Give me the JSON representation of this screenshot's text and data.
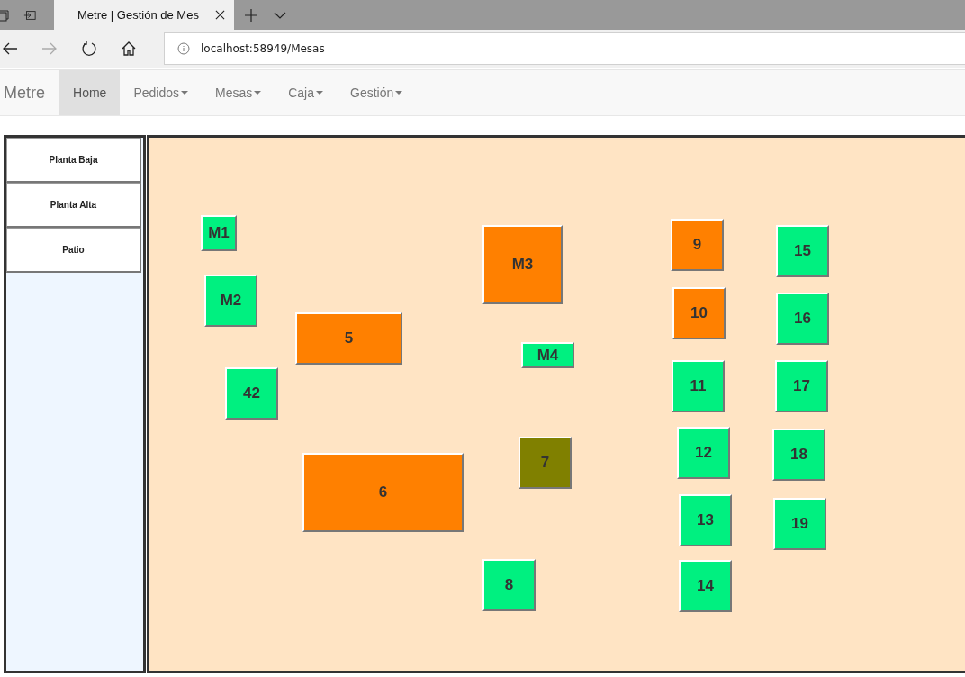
{
  "browser": {
    "tab_title": "Metre | Gestión de Mes",
    "url": "localhost:58949/Mesas"
  },
  "navbar": {
    "brand": "Metre",
    "items": [
      {
        "label": "Home",
        "selected": true,
        "dropdown": false
      },
      {
        "label": "Pedidos",
        "selected": false,
        "dropdown": true
      },
      {
        "label": "Mesas",
        "selected": false,
        "dropdown": true
      },
      {
        "label": "Caja",
        "selected": false,
        "dropdown": true
      },
      {
        "label": "Gestión",
        "selected": false,
        "dropdown": true
      }
    ]
  },
  "sidebar": {
    "items": [
      {
        "label": "Planta Baja"
      },
      {
        "label": "Planta Alta"
      },
      {
        "label": "Patio"
      }
    ]
  },
  "tables": [
    {
      "label": "M1",
      "color": "#00f080"
    },
    {
      "label": "M2",
      "color": "#00f080"
    },
    {
      "label": "42",
      "color": "#00f080"
    },
    {
      "label": "5",
      "color": "#ff8000"
    },
    {
      "label": "6",
      "color": "#ff8000"
    },
    {
      "label": "M3",
      "color": "#ff8000"
    },
    {
      "label": "M4",
      "color": "#00f080"
    },
    {
      "label": "7",
      "color": "#808000"
    },
    {
      "label": "8",
      "color": "#00f080"
    },
    {
      "label": "9",
      "color": "#ff8000"
    },
    {
      "label": "10",
      "color": "#ff8000"
    },
    {
      "label": "11",
      "color": "#00f080"
    },
    {
      "label": "12",
      "color": "#00f080"
    },
    {
      "label": "13",
      "color": "#00f080"
    },
    {
      "label": "14",
      "color": "#00f080"
    },
    {
      "label": "15",
      "color": "#00f080"
    },
    {
      "label": "16",
      "color": "#00f080"
    },
    {
      "label": "17",
      "color": "#00f080"
    },
    {
      "label": "18",
      "color": "#00f080"
    },
    {
      "label": "19",
      "color": "#00f080"
    }
  ]
}
